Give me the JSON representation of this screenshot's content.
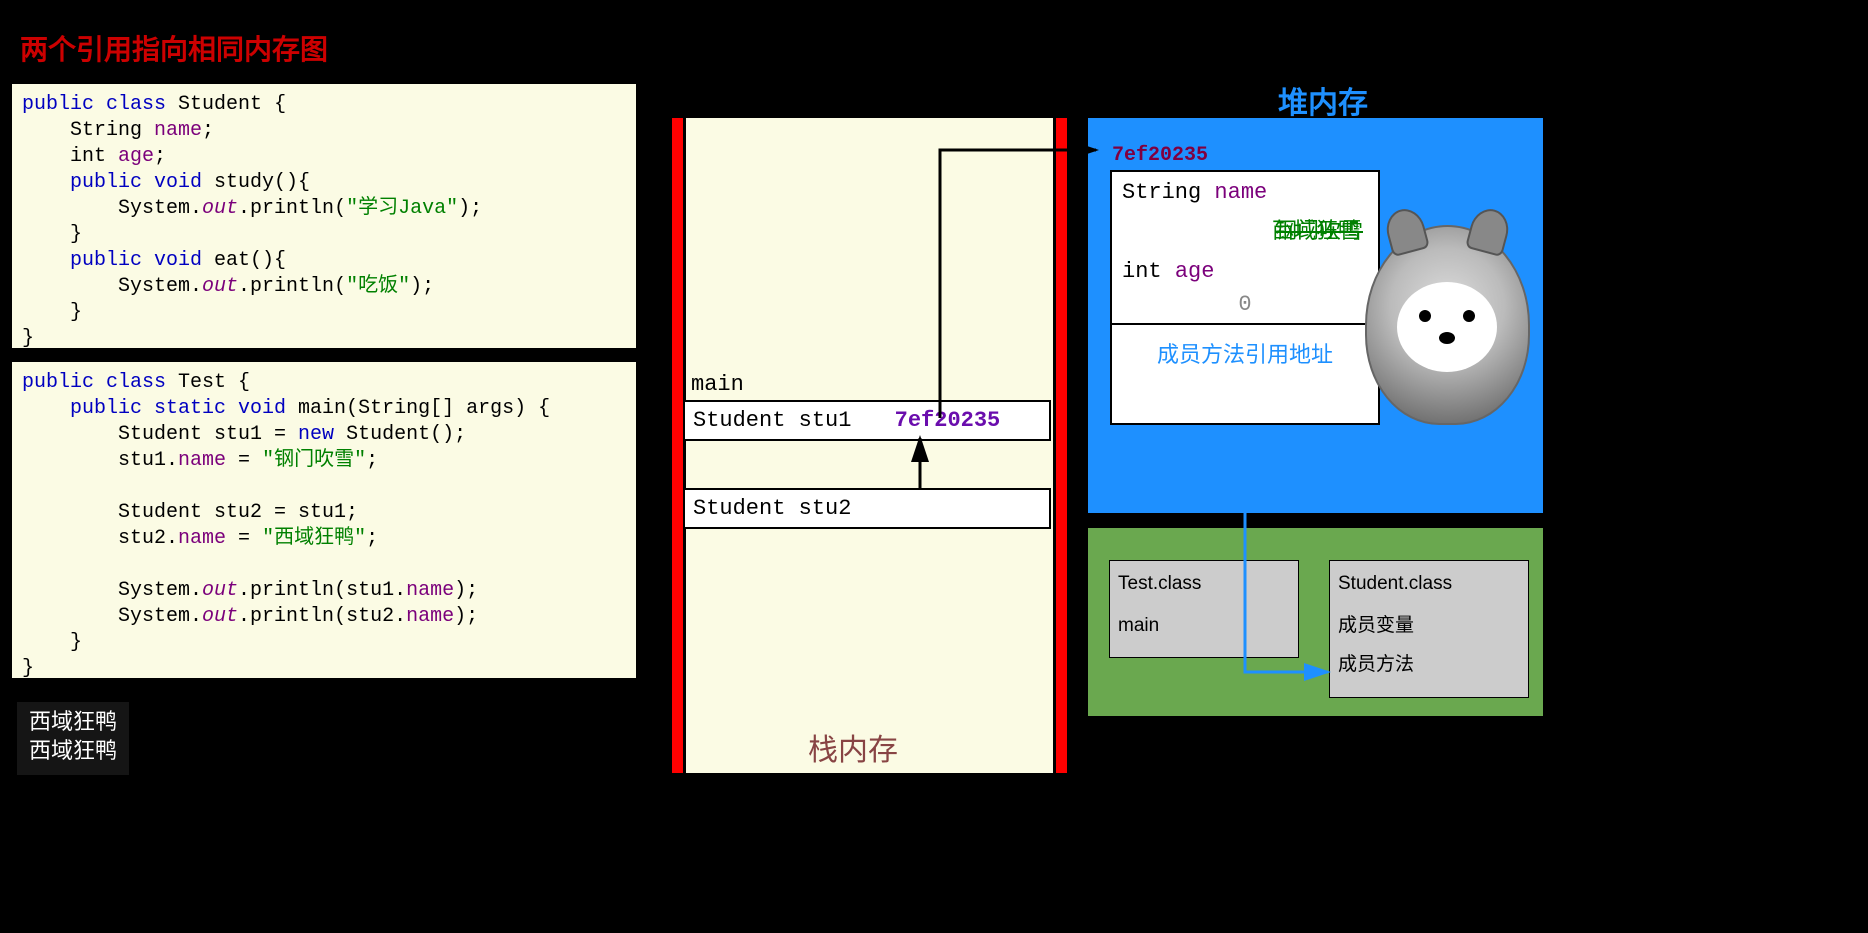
{
  "title": "两个引用指向相同内存图",
  "code_student": {
    "l1a": "public",
    "l1b": "class",
    "l1c": " Student {",
    "l2a": "    String ",
    "l2b": "name",
    "l2c": ";",
    "l3a": "    int ",
    "l3b": "age",
    "l3c": ";",
    "l4a": "    public void ",
    "l4b": "study",
    "l4c": "(){",
    "l5a": "        System.",
    "l5b": "out",
    "l5c": ".println(",
    "l5d": "\"学习Java\"",
    "l5e": ");",
    "l6": "    }",
    "l7a": "    public void ",
    "l7b": "eat",
    "l7c": "(){",
    "l8a": "        System.",
    "l8b": "out",
    "l8c": ".println(",
    "l8d": "\"吃饭\"",
    "l8e": ");",
    "l9": "    }",
    "l10": "}"
  },
  "code_test": {
    "l1a": "public",
    "l1b": "class",
    "l1c": " Test {",
    "l2a": "    public static void ",
    "l2b": "main",
    "l2c": "(String[] args) {",
    "l3a": "        Student stu1 = ",
    "l3b": "new",
    "l3c": " Student();",
    "l4a": "        stu1.",
    "l4b": "name",
    "l4c": " = ",
    "l4d": "\"钢门吹雪\"",
    "l4e": ";",
    "l5": "",
    "l6": "        Student stu2 = stu1;",
    "l7a": "        stu2.",
    "l7b": "name",
    "l7c": " = ",
    "l7d": "\"西域狂鸭\"",
    "l7e": ";",
    "l8": "",
    "l9a": "        System.",
    "l9b": "out",
    "l9c": ".println(stu1.",
    "l9d": "name",
    "l9e": ");",
    "l10a": "        System.",
    "l10b": "out",
    "l10c": ".println(stu2.",
    "l10d": "name",
    "l10e": ");",
    "l11": "    }",
    "l12": "}"
  },
  "output": {
    "line1": "西域狂鸭",
    "line2": "西域狂鸭"
  },
  "stack": {
    "label": "栈内存",
    "main": "main",
    "stu1": "Student stu1",
    "stu1_addr": "7ef20235",
    "stu2": "Student stu2"
  },
  "heap": {
    "label": "堆内存",
    "addr": "7ef20235",
    "f1_type": "String",
    "f1_name": "name",
    "f1_old": "钢门吹雪",
    "f1_new": "西域狂鸭",
    "f2_type": "int",
    "f2_name": "age",
    "f2_val": "0",
    "method_ref": "成员方法引用地址"
  },
  "method_area": {
    "test_name": "Test.class",
    "test_members": "main",
    "student_name": "Student.class",
    "student_m1": "成员变量",
    "student_m2": "成员方法"
  }
}
